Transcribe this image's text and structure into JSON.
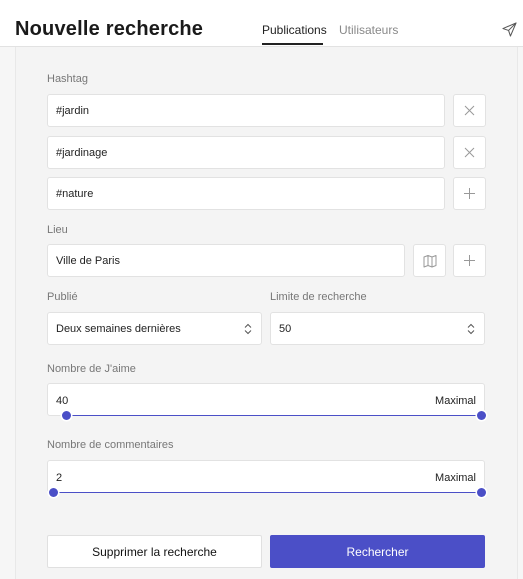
{
  "header": {
    "title": "Nouvelle recherche",
    "tabs": [
      {
        "label": "Publications",
        "active": true
      },
      {
        "label": "Utilisateurs",
        "active": false
      }
    ],
    "send_icon": "send-icon"
  },
  "hashtag": {
    "label": "Hashtag",
    "entries": [
      {
        "value": "#jardin",
        "action": "remove",
        "icon": "close-icon"
      },
      {
        "value": "#jardinage",
        "action": "remove",
        "icon": "close-icon"
      },
      {
        "value": "#nature",
        "action": "add",
        "icon": "plus-icon"
      }
    ]
  },
  "lieu": {
    "label": "Lieu",
    "value": "Ville de Paris",
    "map_icon": "map-icon",
    "add_icon": "plus-icon"
  },
  "publie": {
    "label": "Publié",
    "selected": "Deux semaines dernières"
  },
  "limite": {
    "label": "Limite de recherche",
    "selected": "50"
  },
  "likes": {
    "label": "Nombre de J'aime",
    "min_value": "40",
    "max_label": "Maximal",
    "min_fraction": 0.03,
    "max_fraction": 1.0
  },
  "comments": {
    "label": "Nombre de commentaires",
    "min_value": "2",
    "max_label": "Maximal",
    "min_fraction": 0.0,
    "max_fraction": 1.0
  },
  "actions": {
    "delete_label": "Supprimer la recherche",
    "search_label": "Rechercher"
  },
  "colors": {
    "accent": "#4b4fc7",
    "background": "#f4f4f4"
  }
}
